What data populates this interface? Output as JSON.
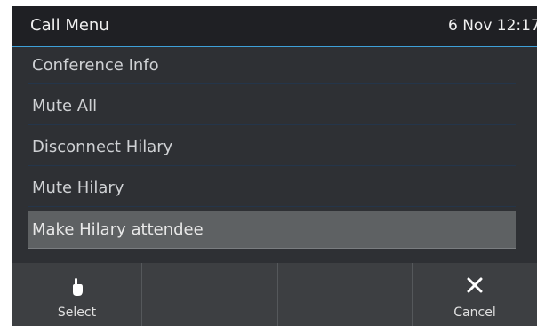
{
  "header": {
    "title": "Call Menu",
    "datetime": "6 Nov 12:17"
  },
  "menu": {
    "items": [
      {
        "label": "Conference Info"
      },
      {
        "label": "Mute All"
      },
      {
        "label": "Disconnect Hilary"
      },
      {
        "label": "Mute Hilary"
      },
      {
        "label": "Make Hilary attendee",
        "selected": true
      }
    ]
  },
  "softkeys": [
    {
      "label": "Select",
      "icon": "hand-pointer-icon"
    },
    {
      "label": "",
      "icon": ""
    },
    {
      "label": "",
      "icon": ""
    },
    {
      "label": "Cancel",
      "icon": "close-icon"
    }
  ],
  "colors": {
    "accent": "#3ea0d8",
    "background": "#2e3034",
    "selected": "#5e6163"
  }
}
